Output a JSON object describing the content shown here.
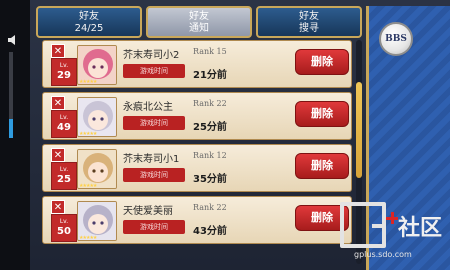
{
  "tabs": [
    {
      "line1": "好友",
      "line2": "24/25"
    },
    {
      "line1": "好友",
      "line2": "通知"
    },
    {
      "line1": "好友",
      "line2": "搜寻"
    }
  ],
  "bbs_label": "BBS",
  "level_prefix": "Lv.",
  "status_pill": "游戏时间",
  "delete_label": "删除",
  "friends": [
    {
      "level": "29",
      "name": "芥末寿司小2",
      "rank": "Rank 15",
      "time": "21分前",
      "hair": "#e06b8f"
    },
    {
      "level": "49",
      "name": "永痕北公主",
      "rank": "Rank 22",
      "time": "25分前",
      "hair": "#c9c4d6"
    },
    {
      "level": "25",
      "name": "芥末寿司小1",
      "rank": "Rank 12",
      "time": "35分前",
      "hair": "#d9b27a"
    },
    {
      "level": "50",
      "name": "天使爱美丽",
      "rank": "Rank 22",
      "time": "43分前",
      "hair": "#b7b2c9"
    }
  ],
  "volume_level": 0.22,
  "watermark": {
    "brand": "社区",
    "site": "gplus.sdo.com"
  }
}
